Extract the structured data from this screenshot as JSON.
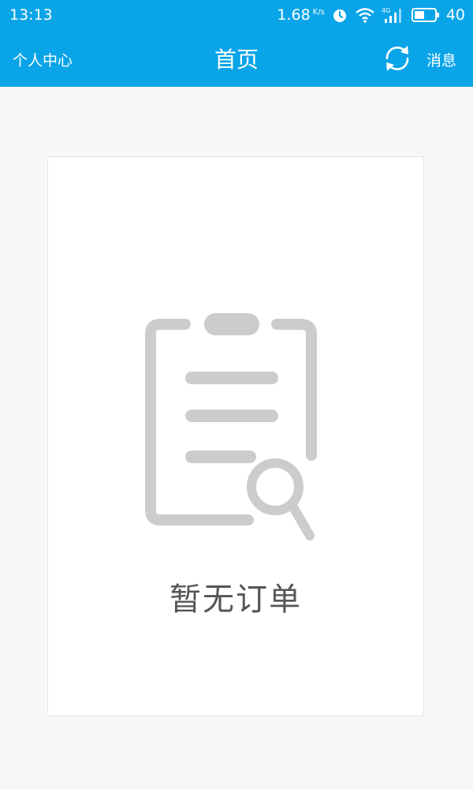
{
  "status_bar": {
    "time": "13:13",
    "net_speed": "1.68",
    "net_speed_unit": "K/s",
    "signal_label": "4G",
    "battery": "40",
    "icons": [
      "alarm-icon",
      "wifi-icon",
      "signal-icon",
      "battery-icon"
    ]
  },
  "nav": {
    "left_label": "个人中心",
    "title": "首页",
    "refresh_icon": "refresh-icon",
    "right_label": "消息"
  },
  "empty_state": {
    "icon": "clipboard-search-icon",
    "message": "暂无订单"
  },
  "colors": {
    "header": "#0aa4e8",
    "background": "#f7f7f7",
    "icon_gray": "#cccccc",
    "text_gray": "#555555"
  }
}
